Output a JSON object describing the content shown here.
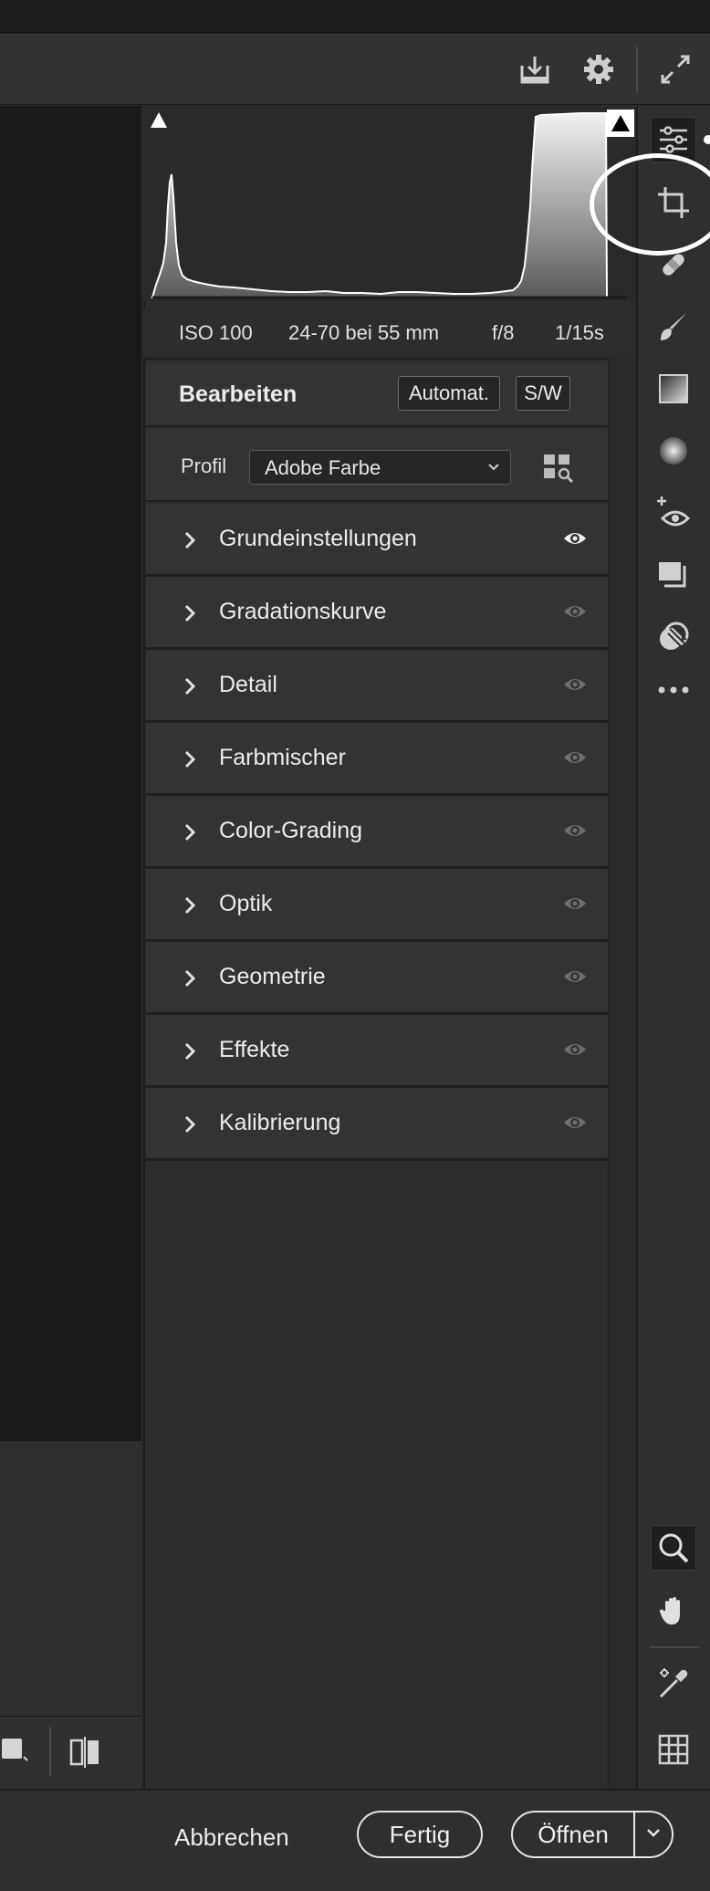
{
  "metadata": {
    "iso": "ISO 100",
    "lens": "24-70 bei 55 mm",
    "aperture": "f/8",
    "shutter": "1/15s"
  },
  "edit_panel": {
    "title": "Bearbeiten",
    "auto_label": "Automat.",
    "bw_label": "S/W",
    "profile_label": "Profil",
    "profile_value": "Adobe Farbe"
  },
  "sections": [
    {
      "label": "Grundeinstellungen",
      "visible_active": true
    },
    {
      "label": "Gradationskurve",
      "visible_active": false
    },
    {
      "label": "Detail",
      "visible_active": false
    },
    {
      "label": "Farbmischer",
      "visible_active": false
    },
    {
      "label": "Color-Grading",
      "visible_active": false
    },
    {
      "label": "Optik",
      "visible_active": false
    },
    {
      "label": "Geometrie",
      "visible_active": false
    },
    {
      "label": "Effekte",
      "visible_active": false
    },
    {
      "label": "Kalibrierung",
      "visible_active": false
    }
  ],
  "footer": {
    "cancel_label": "Abbrechen",
    "done_label": "Fertig",
    "open_label": "Öffnen"
  },
  "toolbar_icons": [
    "save-icon",
    "gear-icon",
    "fullscreen-icon"
  ],
  "rail_icons": [
    "edit-sliders-icon",
    "crop-icon",
    "healing-icon",
    "brush-icon",
    "linear-gradient-icon",
    "radial-gradient-icon",
    "red-eye-icon",
    "snapshots-icon",
    "presets-icon",
    "more-icon",
    "zoom-icon",
    "hand-icon",
    "color-sampler-icon",
    "grid-icon"
  ],
  "colors": {
    "panel_bg": "#333333",
    "canvas_bg": "#191919",
    "highlight": "#ffffff"
  }
}
